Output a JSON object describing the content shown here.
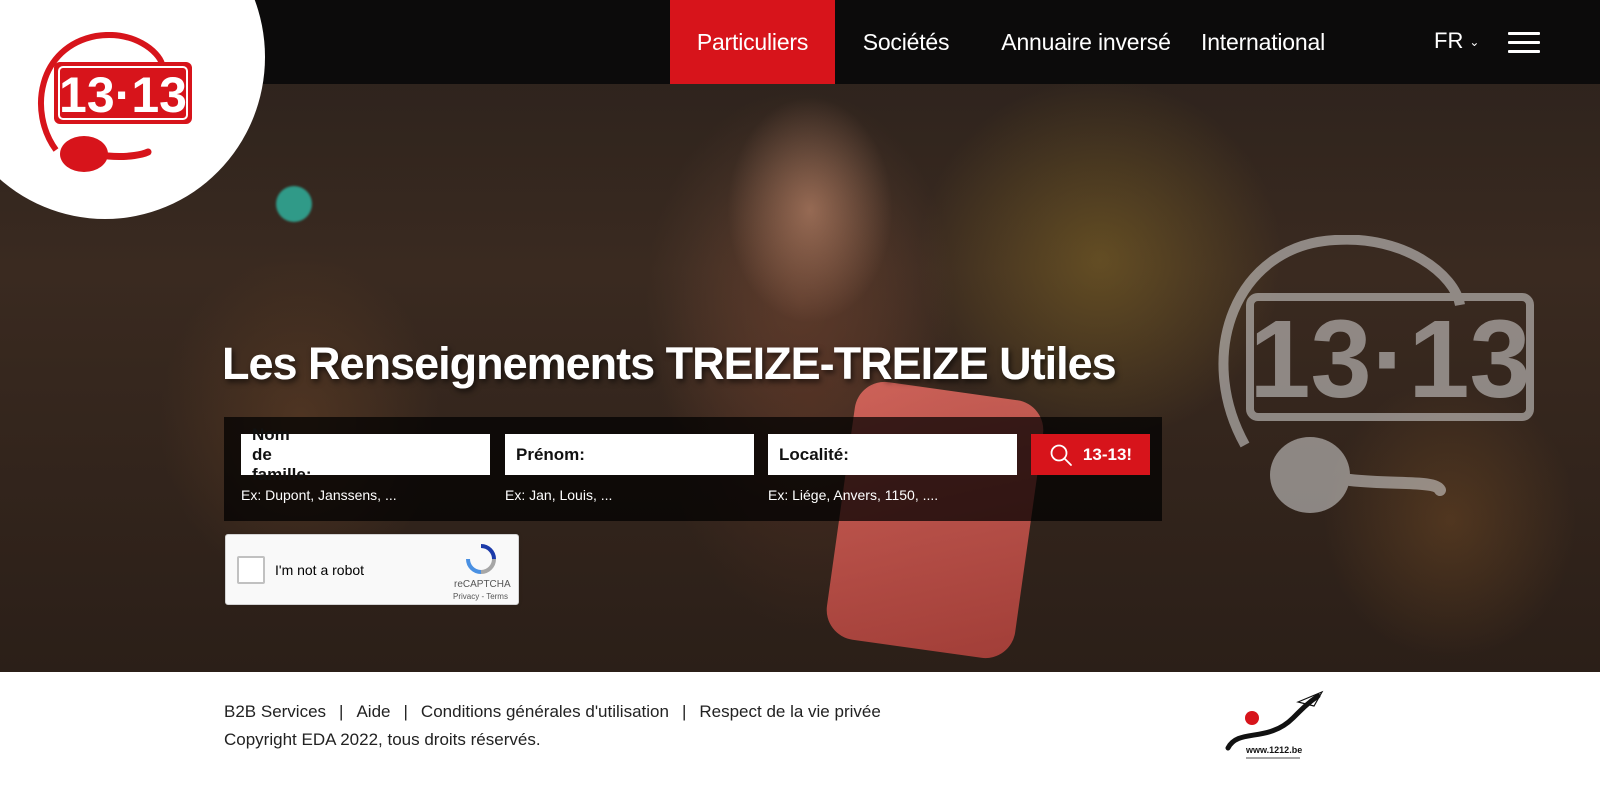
{
  "brand": {
    "logo_text": "13·13",
    "accent_color": "#d7141b"
  },
  "nav": {
    "items": [
      "Particuliers",
      "Sociétés",
      "Annuaire inversé",
      "International"
    ],
    "active_index": 0,
    "language": "FR"
  },
  "hero": {
    "headline": "Les Renseignements TREIZE-TREIZE Utiles",
    "watermark_text": "13·13"
  },
  "search": {
    "fields": [
      {
        "label": "Nom de famille:",
        "value": "",
        "hint": "Ex: Dupont, Janssens, ..."
      },
      {
        "label": "Prénom:",
        "value": "",
        "hint": "Ex: Jan, Louis, ..."
      },
      {
        "label": "Localité:",
        "value": "",
        "hint": "Ex: Liége, Anvers, 1150, ...."
      }
    ],
    "button_label": "13-13!"
  },
  "recaptcha": {
    "label": "I'm not a robot",
    "brand": "reCAPTCHA",
    "links": "Privacy - Terms"
  },
  "footer": {
    "links": [
      "B2B Services",
      "Aide",
      "Conditions générales d'utilisation",
      "Respect de la vie privée"
    ],
    "copyright": "Copyright EDA 2022, tous droits réservés.",
    "partner_logo_text": "www.1212.be"
  }
}
